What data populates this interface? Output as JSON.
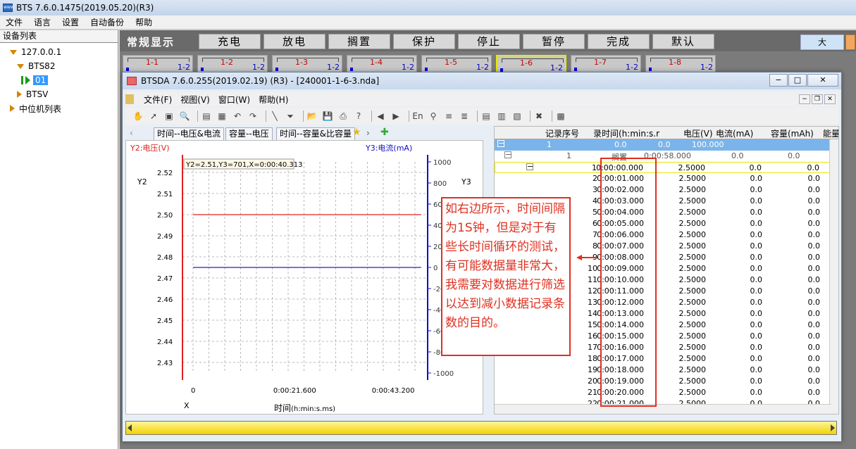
{
  "outer_window": {
    "title": "BTS 7.6.0.1475(2019.05.20)(R3)",
    "icon_text": "www"
  },
  "outer_menu": [
    "文件",
    "语言",
    "设置",
    "自动备份",
    "帮助"
  ],
  "tree": {
    "header": "设备列表",
    "nodes": [
      "127.0.0.1",
      "BTS82",
      "01",
      "BTSV",
      "中位机列表"
    ]
  },
  "channel_panel": {
    "title": "常规显示",
    "buttons": [
      "充电",
      "放电",
      "搁置",
      "保护",
      "停止",
      "暂停",
      "完成",
      "默认"
    ],
    "right_button": "大",
    "cards": [
      {
        "name": "1-1",
        "sub": "1-2"
      },
      {
        "name": "1-2",
        "sub": "1-2"
      },
      {
        "name": "1-3",
        "sub": "1-2"
      },
      {
        "name": "1-4",
        "sub": "1-2"
      },
      {
        "name": "1-5",
        "sub": "1-2"
      },
      {
        "name": "1-6",
        "sub": "1-2"
      },
      {
        "name": "1-7",
        "sub": "1-2"
      },
      {
        "name": "1-8",
        "sub": "1-2"
      }
    ]
  },
  "inner_window": {
    "title": "BTSDA 7.6.0.255(2019.02.19) (R3) - [240001-1-6-3.nda]",
    "menu": [
      "文件(F)",
      "视图(V)",
      "窗口(W)",
      "帮助(H)"
    ]
  },
  "chart_tabs": [
    "时间--电压&电流",
    "容量--电压",
    "时间--容量&比容量"
  ],
  "chart_data": {
    "type": "line",
    "y2_label": "Y2:电压(V)",
    "y3_label": "Y3:电流(mA)",
    "y2_axis_name": "Y2",
    "y3_axis_name": "Y3",
    "x_axis_name": "X",
    "xlabel": "时间",
    "xlabel_unit": "(h:min:s.ms)",
    "tooltip": "Y2=2.51,Y3=701,X=0:00:40.313",
    "y2_ticks": [
      "2.52",
      "2.51",
      "2.50",
      "2.49",
      "2.48",
      "2.47",
      "2.46",
      "2.45",
      "2.44",
      "2.43"
    ],
    "y3_ticks": [
      "1000",
      "800",
      "600",
      "400",
      "200",
      "0",
      "-200",
      "-400",
      "-600",
      "-800",
      "-1000"
    ],
    "x_ticks": [
      "0",
      "0:00:21.600",
      "0:00:43.200"
    ],
    "y2_range": [
      2.425,
      2.525
    ],
    "y3_range": [
      -1000,
      1000
    ],
    "x_range_s": [
      0,
      50.4
    ],
    "series": [
      {
        "name": "电压",
        "axis": "y2",
        "color": "#e02020",
        "x": [
          0,
          50
        ],
        "values": [
          2.5,
          2.5
        ]
      },
      {
        "name": "电流",
        "axis": "y3",
        "color": "#2020c0",
        "x": [
          0,
          50
        ],
        "values": [
          0,
          0
        ]
      }
    ]
  },
  "table": {
    "headers": [
      "记录序号",
      "录时间(h:min:s.r",
      "电压(V)",
      "电流(mA)",
      "容量(mAh)",
      "能量"
    ],
    "group1": {
      "id": "1",
      "a": "0.0",
      "b": "0.0",
      "c": "100.000"
    },
    "group2": {
      "id": "1",
      "state": "搁置",
      "time": "0:00:58.000",
      "a": "0.0",
      "b": "0.0"
    },
    "rows": [
      [
        "1",
        "0:00:00.000",
        "2.5000",
        "0.0",
        "0.0"
      ],
      [
        "2",
        "0:00:01.000",
        "2.5000",
        "0.0",
        "0.0"
      ],
      [
        "3",
        "0:00:02.000",
        "2.5000",
        "0.0",
        "0.0"
      ],
      [
        "4",
        "0:00:03.000",
        "2.5000",
        "0.0",
        "0.0"
      ],
      [
        "5",
        "0:00:04.000",
        "2.5000",
        "0.0",
        "0.0"
      ],
      [
        "6",
        "0:00:05.000",
        "2.5000",
        "0.0",
        "0.0"
      ],
      [
        "7",
        "0:00:06.000",
        "2.5000",
        "0.0",
        "0.0"
      ],
      [
        "8",
        "0:00:07.000",
        "2.5000",
        "0.0",
        "0.0"
      ],
      [
        "9",
        "0:00:08.000",
        "2.5000",
        "0.0",
        "0.0"
      ],
      [
        "10",
        "0:00:09.000",
        "2.5000",
        "0.0",
        "0.0"
      ],
      [
        "11",
        "0:00:10.000",
        "2.5000",
        "0.0",
        "0.0"
      ],
      [
        "12",
        "0:00:11.000",
        "2.5000",
        "0.0",
        "0.0"
      ],
      [
        "13",
        "0:00:12.000",
        "2.5000",
        "0.0",
        "0.0"
      ],
      [
        "14",
        "0:00:13.000",
        "2.5000",
        "0.0",
        "0.0"
      ],
      [
        "15",
        "0:00:14.000",
        "2.5000",
        "0.0",
        "0.0"
      ],
      [
        "16",
        "0:00:15.000",
        "2.5000",
        "0.0",
        "0.0"
      ],
      [
        "17",
        "0:00:16.000",
        "2.5000",
        "0.0",
        "0.0"
      ],
      [
        "18",
        "0:00:17.000",
        "2.5000",
        "0.0",
        "0.0"
      ],
      [
        "19",
        "0:00:18.000",
        "2.5000",
        "0.0",
        "0.0"
      ],
      [
        "20",
        "0:00:19.000",
        "2.5000",
        "0.0",
        "0.0"
      ],
      [
        "21",
        "0:00:20.000",
        "2.5000",
        "0.0",
        "0.0"
      ],
      [
        "22",
        "0:00:21.000",
        "2.5000",
        "0.0",
        "0.0"
      ]
    ]
  },
  "annotation": "如右边所示，时间间隔为1S钟，但是对于有些长时间循环的测试，有可能数据量非常大，我需要对数据进行筛选以达到减小数据记录条数的目的。",
  "colors": {
    "annotation": "#e03020",
    "voltage": "#e02020",
    "current": "#2020c0",
    "status_bar": "#f2d200"
  }
}
